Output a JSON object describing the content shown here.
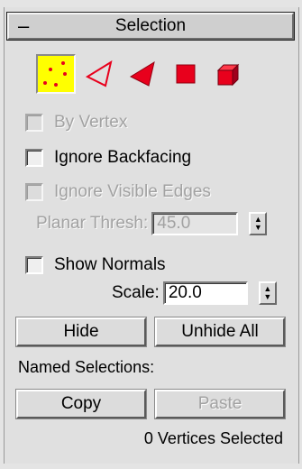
{
  "rollout": {
    "collapse_glyph": "–",
    "title": "Selection"
  },
  "modes": [
    {
      "name": "vertex",
      "icon": "vertex-dots-icon",
      "active": true
    },
    {
      "name": "edge",
      "icon": "edge-triangle-outline-icon",
      "active": false
    },
    {
      "name": "face",
      "icon": "face-triangle-icon",
      "active": false
    },
    {
      "name": "polygon",
      "icon": "polygon-square-icon",
      "active": false
    },
    {
      "name": "element",
      "icon": "element-cube-icon",
      "active": false
    }
  ],
  "colors": {
    "active_mode_bg": "#ffff00",
    "icon_red": "#e8001c",
    "panel_bg": "#e0e0e0"
  },
  "options": {
    "by_vertex": {
      "label": "By Vertex",
      "checked": false,
      "enabled": false
    },
    "ignore_backfacing": {
      "label": "Ignore Backfacing",
      "checked": false,
      "enabled": true
    },
    "ignore_visible_edges": {
      "label": "Ignore Visible Edges",
      "checked": false,
      "enabled": false
    },
    "planar_thresh": {
      "label": "Planar Thresh:",
      "value": "45.0",
      "enabled": false
    },
    "show_normals": {
      "label": "Show Normals",
      "checked": false,
      "enabled": true
    },
    "scale": {
      "label": "Scale:",
      "value": "20.0",
      "enabled": true
    }
  },
  "buttons": {
    "hide": "Hide",
    "unhide_all": "Unhide All",
    "copy": "Copy",
    "paste": "Paste"
  },
  "named_selections_label": "Named Selections:",
  "status": "0 Vertices Selected",
  "spinner_glyphs": {
    "up": "▲",
    "down": "▼"
  }
}
